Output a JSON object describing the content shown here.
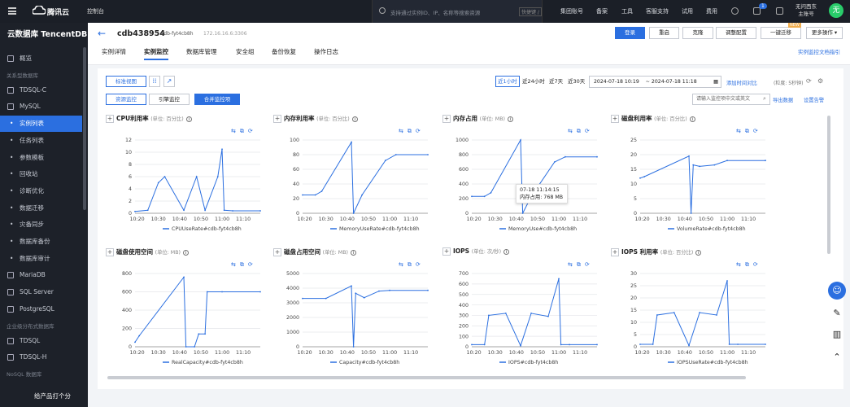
{
  "topbar": {
    "brand": "腾讯云",
    "console": "控制台",
    "search_placeholder": "支持通过实例ID、IP、名称等搜索资源",
    "shortcut": "快捷键 /",
    "nav": [
      "集团账号",
      "备案",
      "工具",
      "客服支持",
      "试用",
      "费用"
    ],
    "notice_count": "1",
    "user_line1": "无问西东",
    "user_line2": "主账号",
    "avatar": "无"
  },
  "sidebar": {
    "title": "云数据库 TencentDB",
    "items": [
      {
        "label": "概览",
        "kind": "item"
      },
      {
        "label": "关系型数据库",
        "kind": "group"
      },
      {
        "label": "TDSQL-C",
        "kind": "item"
      },
      {
        "label": "MySQL",
        "kind": "item"
      },
      {
        "label": "实例列表",
        "kind": "active"
      },
      {
        "label": "任务列表",
        "kind": "sub"
      },
      {
        "label": "参数模板",
        "kind": "sub"
      },
      {
        "label": "回收站",
        "kind": "sub"
      },
      {
        "label": "诊断优化",
        "kind": "sub"
      },
      {
        "label": "数据迁移",
        "kind": "sub"
      },
      {
        "label": "灾备同步",
        "kind": "sub"
      },
      {
        "label": "数据库备份",
        "kind": "sub"
      },
      {
        "label": "数据库审计",
        "kind": "sub"
      },
      {
        "label": "MariaDB",
        "kind": "item"
      },
      {
        "label": "SQL Server",
        "kind": "item"
      },
      {
        "label": "PostgreSQL",
        "kind": "item"
      },
      {
        "label": "企业级分布式数据库",
        "kind": "group"
      },
      {
        "label": "TDSQL",
        "kind": "item"
      },
      {
        "label": "TDSQL-H",
        "kind": "item"
      },
      {
        "label": "NoSQL 数据库",
        "kind": "group"
      }
    ],
    "bottom": "给产品打个分"
  },
  "header": {
    "instance_name": "cdb438954",
    "instance_id": "cdb-fyt4cb8h",
    "ip": "172.16.16.6:3306",
    "buttons": [
      "登录",
      "重启",
      "克隆",
      "调整配置",
      "一键迁移",
      "更多操作 ▾"
    ],
    "new_tag": "NEW",
    "tabs": [
      "实例详情",
      "实例监控",
      "数据库管理",
      "安全组",
      "备份恢复",
      "操作日志"
    ],
    "help_link": "实例监控文档指引"
  },
  "toolbar": {
    "view_standard": "标准视图",
    "view_resource": "资源监控",
    "view_engine": "引擎监控",
    "merge": "合并监控项",
    "ranges": [
      "近1小时",
      "近24小时",
      "近7天",
      "近30天"
    ],
    "date_from": "2024-07-18 10:19",
    "date_to": "~ 2024-07-18 11:18",
    "compare": "添加时间对比",
    "granularity": "(粒度: 5秒钟)",
    "search_placeholder": "请输入监控项中文或英文",
    "export": "导出数据",
    "alarm": "设置告警"
  },
  "charts": [
    {
      "title": "CPU利用率",
      "unit": "(单位: 百分比)",
      "legend": "CPUUseRate#cdb-fyt4cb8h",
      "ylim": [
        0,
        12
      ],
      "yticks": [
        0,
        2,
        4,
        6,
        8,
        10,
        12
      ],
      "xticks": [
        "10:20",
        "10:30",
        "10:40",
        "10:50",
        "11:00",
        "11:10"
      ],
      "chart_data": {
        "type": "line",
        "x": [
          "10:19",
          "10:25",
          "10:30",
          "10:33",
          "10:42",
          "10:48",
          "10:52",
          "10:58",
          "11:00",
          "11:01",
          "11:05",
          "11:18"
        ],
        "series": [
          {
            "name": "CPUUseRate#cdb-fyt4cb8h",
            "values": [
              0.3,
              0.5,
              5,
              6,
              0.5,
              6,
              0.5,
              6,
              10.5,
              0.5,
              0.4,
              0.4
            ]
          }
        ]
      }
    },
    {
      "title": "内存利用率",
      "unit": "(单位: 百分比)",
      "legend": "MemoryUseRate#cdb-fyt4cb8h",
      "ylim": [
        0,
        100
      ],
      "yticks": [
        0,
        20,
        40,
        60,
        80,
        100
      ],
      "xticks": [
        "10:20",
        "10:30",
        "10:40",
        "10:50",
        "11:00",
        "11:10"
      ],
      "chart_data": {
        "type": "line",
        "x": [
          "10:19",
          "10:25",
          "10:28",
          "10:42",
          "10:43",
          "10:47",
          "10:58",
          "11:03",
          "11:18"
        ],
        "series": [
          {
            "name": "MemoryUseRate#cdb-fyt4cb8h",
            "values": [
              25,
              25,
              30,
              97,
              0,
              25,
              72,
              80,
              80
            ]
          }
        ]
      }
    },
    {
      "title": "内存占用",
      "unit": "(单位: MB)",
      "legend": "MemoryUse#cdb-fyt4cb8h",
      "ylim": [
        0,
        1000
      ],
      "yticks": [
        0,
        200,
        400,
        600,
        800,
        1000
      ],
      "xticks": [
        "10:20",
        "10:30",
        "10:40",
        "10:50",
        "11:00",
        "11:10"
      ],
      "tooltip": {
        "time": "07-18 11:14:15",
        "text": "内存占用: 768 MB"
      },
      "chart_data": {
        "type": "line",
        "x": [
          "10:19",
          "10:25",
          "10:28",
          "10:42",
          "10:43",
          "10:47",
          "10:58",
          "11:03",
          "11:18"
        ],
        "series": [
          {
            "name": "MemoryUse#cdb-fyt4cb8h",
            "values": [
              230,
              230,
              280,
              1000,
              0,
              230,
              700,
              770,
              770
            ]
          }
        ]
      }
    },
    {
      "title": "磁盘利用率",
      "unit": "(单位: 百分比)",
      "legend": "VolumeRate#cdb-fyt4cb8h",
      "ylim": [
        0,
        25
      ],
      "yticks": [
        0,
        5,
        10,
        15,
        20,
        25
      ],
      "xticks": [
        "10:20",
        "10:30",
        "10:40",
        "10:50",
        "11:00",
        "11:10"
      ],
      "chart_data": {
        "type": "line",
        "x": [
          "10:19",
          "10:21",
          "10:42",
          "10:43",
          "10:44",
          "10:47",
          "10:54",
          "11:00",
          "11:18"
        ],
        "series": [
          {
            "name": "VolumeRate#cdb-fyt4cb8h",
            "values": [
              12,
              12.5,
              19.5,
              0,
              16.5,
              16,
              16.5,
              18,
              18
            ]
          }
        ]
      }
    },
    {
      "title": "磁盘使用空间",
      "unit": "(单位: MB)",
      "legend": "RealCapacity#cdb-fyt4cb8h",
      "ylim": [
        0,
        800
      ],
      "yticks": [
        0,
        200,
        400,
        600,
        800
      ],
      "xticks": [
        "10:20",
        "10:30",
        "10:40",
        "10:50",
        "11:00",
        "11:10"
      ],
      "chart_data": {
        "type": "line",
        "x": [
          "10:19",
          "10:21",
          "10:42",
          "10:43",
          "10:47",
          "10:49",
          "10:52",
          "10:53",
          "11:00",
          "11:18"
        ],
        "series": [
          {
            "name": "RealCapacity#cdb-fyt4cb8h",
            "values": [
              50,
              120,
              760,
              0,
              0,
              140,
              140,
              600,
              600,
              600
            ]
          }
        ]
      }
    },
    {
      "title": "磁盘占用空间",
      "unit": "(单位: MB)",
      "legend": "Capacity#cdb-fyt4cb8h",
      "ylim": [
        0,
        5000
      ],
      "yticks": [
        0,
        1000,
        2000,
        3000,
        4000,
        5000
      ],
      "xticks": [
        "10:20",
        "10:30",
        "10:40",
        "10:50",
        "11:00",
        "11:10"
      ],
      "chart_data": {
        "type": "line",
        "x": [
          "10:19",
          "10:30",
          "10:42",
          "10:43",
          "10:44",
          "10:48",
          "10:55",
          "11:00",
          "11:18"
        ],
        "series": [
          {
            "name": "Capacity#cdb-fyt4cb8h",
            "values": [
              3300,
              3300,
              4150,
              0,
              3650,
              3350,
              3800,
              3850,
              3850
            ]
          }
        ]
      }
    },
    {
      "title": "IOPS",
      "unit": "(单位: 次/秒)",
      "legend": "IOPS#cdb-fyt4cb8h",
      "ylim": [
        0,
        700
      ],
      "yticks": [
        0,
        100,
        200,
        300,
        400,
        500,
        600,
        700
      ],
      "xticks": [
        "10:20",
        "10:30",
        "10:40",
        "10:50",
        "11:00",
        "11:10"
      ],
      "chart_data": {
        "type": "line",
        "x": [
          "10:19",
          "10:25",
          "10:27",
          "10:35",
          "10:42",
          "10:47",
          "10:55",
          "11:00",
          "11:01",
          "11:05",
          "11:18"
        ],
        "series": [
          {
            "name": "IOPS#cdb-fyt4cb8h",
            "values": [
              20,
              20,
              300,
              320,
              10,
              320,
              290,
              650,
              20,
              20,
              20
            ]
          }
        ]
      }
    },
    {
      "title": "IOPS 利用率",
      "unit": "(单位: 百分比)",
      "legend": "IOPSUseRate#cdb-fyt4cb8h",
      "ylim": [
        0,
        30
      ],
      "yticks": [
        0,
        5,
        10,
        15,
        20,
        25,
        30
      ],
      "xticks": [
        "10:20",
        "10:30",
        "10:40",
        "10:50",
        "11:00",
        "11:10"
      ],
      "chart_data": {
        "type": "line",
        "x": [
          "10:19",
          "10:25",
          "10:27",
          "10:35",
          "10:42",
          "10:47",
          "10:55",
          "11:00",
          "11:01",
          "11:05",
          "11:18"
        ],
        "series": [
          {
            "name": "IOPSUseRate#cdb-fyt4cb8h",
            "values": [
              1,
              1,
              13,
              14,
              0.5,
              14,
              13,
              27,
              1,
              1,
              1
            ]
          }
        ]
      }
    }
  ]
}
